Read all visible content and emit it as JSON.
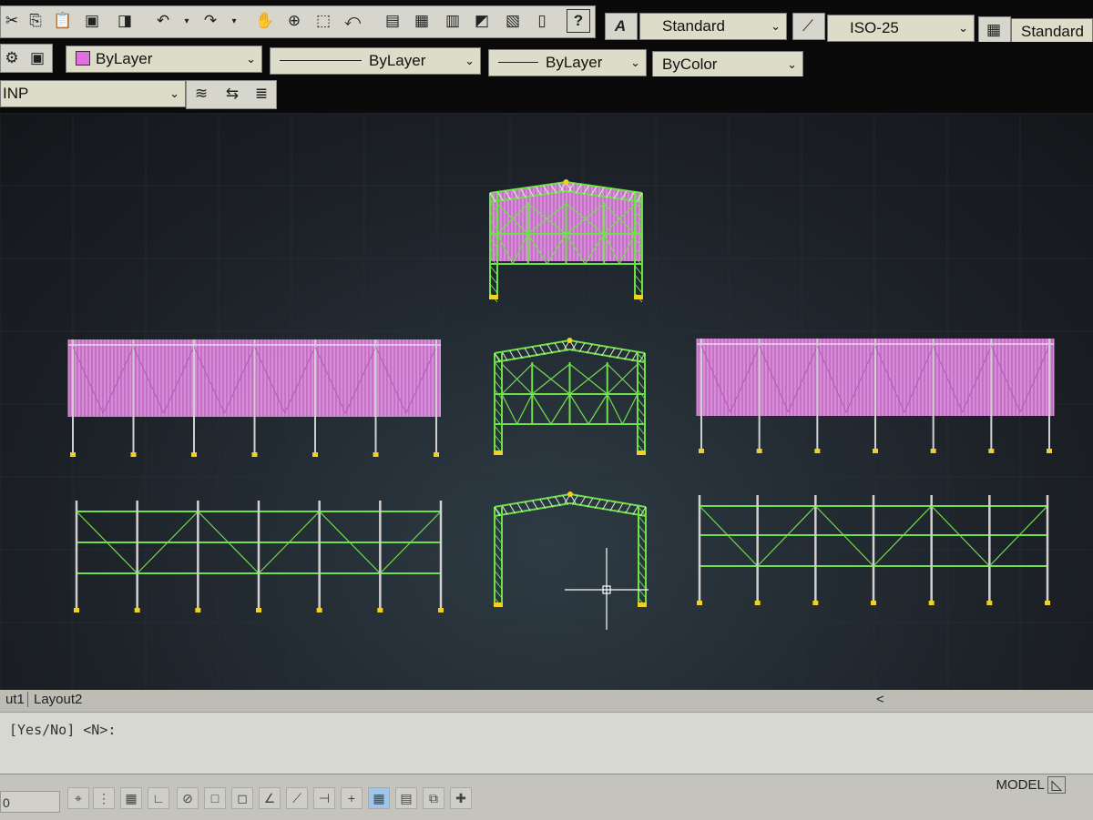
{
  "toolbar": {
    "text_style": "Standard",
    "dim_style": "ISO-25",
    "table_style": "Standard",
    "color_control": "ByLayer",
    "linetype_control": "ByLayer",
    "lineweight_control": "ByLayer",
    "plotstyle_control": "ByColor",
    "layer_name": "INP",
    "help_label": "?"
  },
  "tabs": {
    "layout1": "ut1",
    "layout2": "Layout2",
    "scroll_left": "<"
  },
  "command": {
    "prompt": "[Yes/No] <N>:"
  },
  "status": {
    "coord": "0",
    "model_label": "MODEL"
  },
  "colors": {
    "panel_magenta": "#e07ee0",
    "frame_green": "#6fe04a",
    "column_gray": "#d0d0d0",
    "base_yellow": "#f0d020"
  }
}
